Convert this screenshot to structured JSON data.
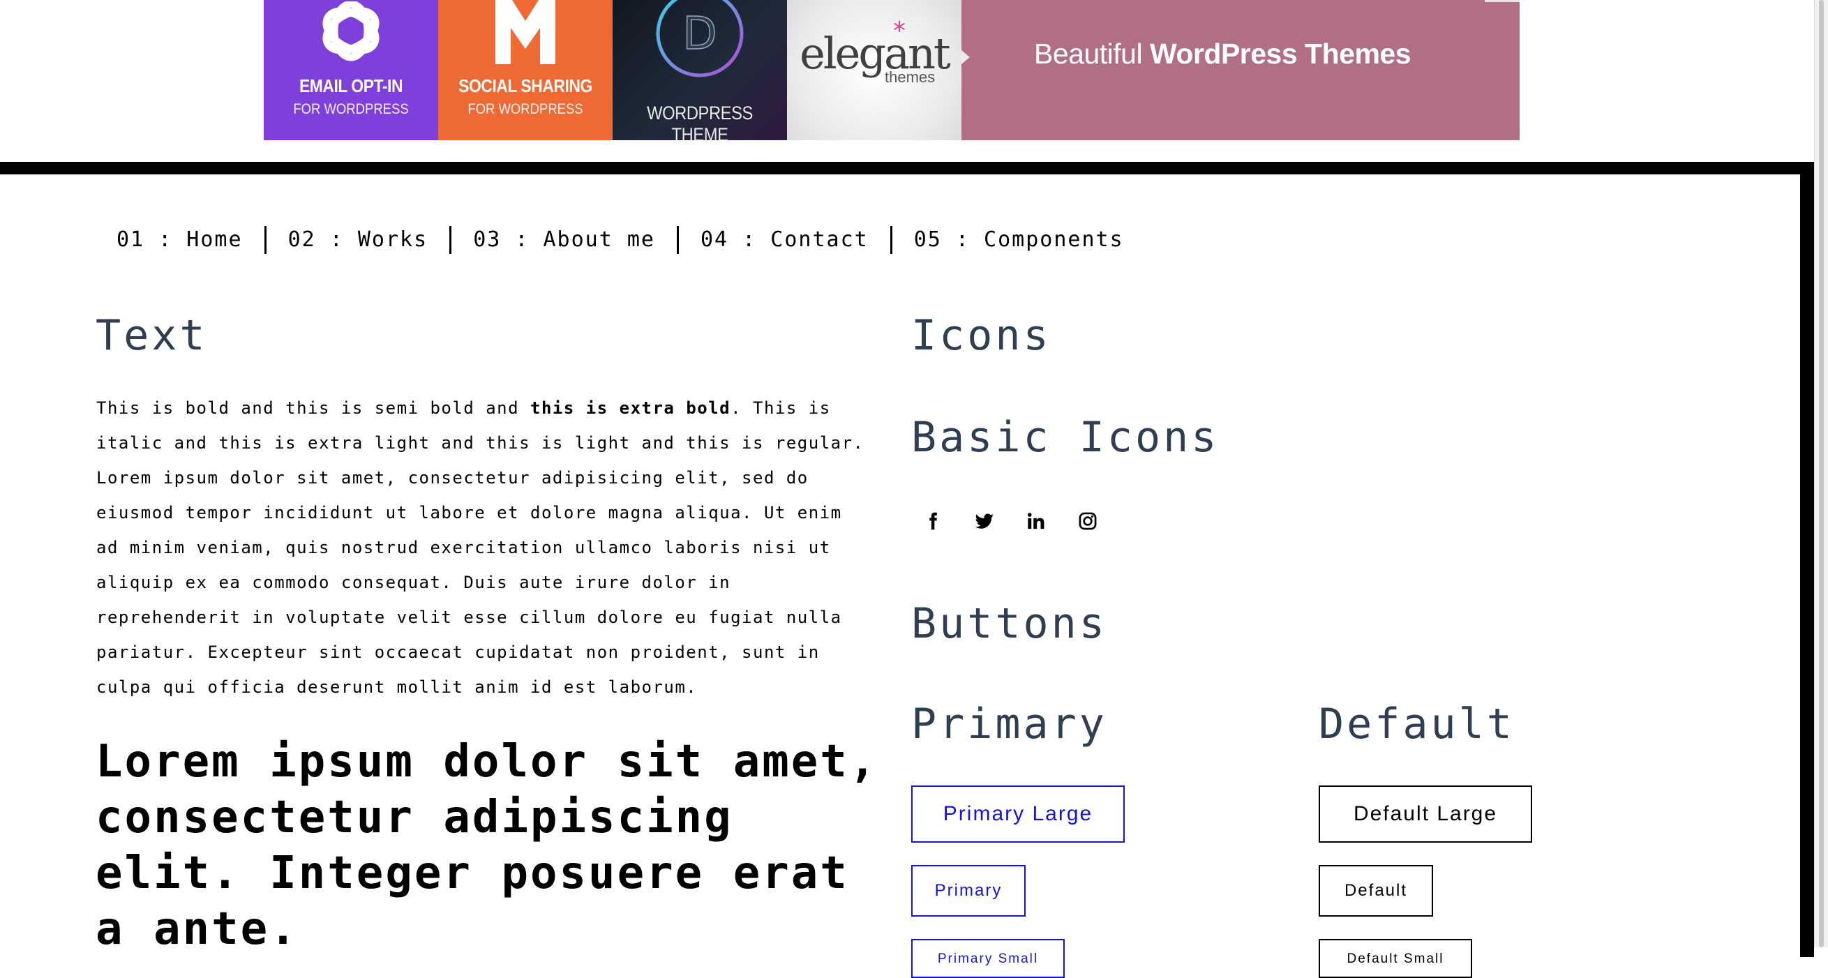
{
  "ad_banner": {
    "tiles": [
      {
        "line1": "EMAIL OPT-IN",
        "line2": "FOR WORDPRESS"
      },
      {
        "line1": "SOCIAL SHARING",
        "line2": "FOR WORDPRESS"
      },
      {
        "line1": "WORDPRESS THEME"
      },
      {
        "wordmark": "elegant",
        "sub": "themes"
      }
    ],
    "tagline_light": "Beautiful ",
    "tagline_bold": "WordPress Themes"
  },
  "nav": {
    "items": [
      "01 : Home",
      "02 : Works",
      "03 : About me",
      "04 : Contact",
      "05 : Components"
    ]
  },
  "text_section": {
    "heading": "Text",
    "p_before_bold": "This is bold and this is semi bold and ",
    "p_bold": "this is extra bold",
    "p_after_bold": ". This is italic and this is extra light and this is light and this is regular. Lorem ipsum dolor sit amet, consectetur adipisicing elit, sed do eiusmod tempor incididunt ut labore et dolore magna aliqua. Ut enim ad minim veniam, quis nostrud exercitation ullamco laboris nisi ut aliquip ex ea commodo consequat. Duis aute irure dolor in reprehenderit in voluptate velit esse cillum dolore eu fugiat nulla pariatur. Excepteur sint occaecat cupidatat non proident, sunt in culpa qui officia deserunt mollit anim id est laborum.",
    "big_text": "Lorem ipsum dolor sit amet, consectetur adipiscing elit. Integer posuere erat a ante."
  },
  "icons_section": {
    "heading": "Icons",
    "basic_heading": "Basic Icons",
    "social_icons": [
      "facebook-icon",
      "twitter-icon",
      "linkedin-icon",
      "instagram-icon"
    ]
  },
  "buttons_section": {
    "heading": "Buttons",
    "primary": {
      "heading": "Primary",
      "large": "Primary Large",
      "regular": "Primary",
      "small": "Primary Small"
    },
    "default": {
      "heading": "Default",
      "large": "Default Large",
      "regular": "Default",
      "small": "Default Small"
    }
  },
  "colors": {
    "primary_blue": "#1414d2",
    "heading_slate": "#2f3e50",
    "frame_black": "#000000",
    "ad_purple": "#7e3fdb",
    "ad_orange": "#ee6934",
    "ad_rose": "#b06f83"
  }
}
